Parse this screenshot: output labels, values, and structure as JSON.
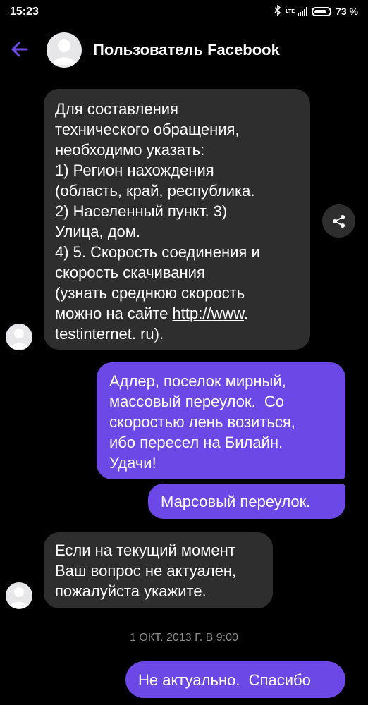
{
  "status_bar": {
    "time": "15:23",
    "network_label": "LTE",
    "battery_text": "73 %",
    "battery_level_percent": 73
  },
  "header": {
    "title": "Пользователь Facebook"
  },
  "messages": [
    {
      "direction": "incoming",
      "text_before_link": "Для составления\nтехнического обращения,\nнеобходимо указать:\n1) Регион нахождения\n(область, край, республика.\n2) Населенный пункт. 3)\nУлица, дом.\n4) 5. Скорость соединения и\nскорость скачивания\n(узнать среднюю скорость\nможно на сайте ",
      "link_text": "http://www",
      "text_after_link": ".\ntestinternet. ru)."
    },
    {
      "direction": "outgoing",
      "text": "Адлер, поселок мирный,\nмассовый переулок.  Со\nскоростью лень возиться,\nибо пересел на Билайн.\nУдачи!"
    },
    {
      "direction": "outgoing",
      "text": "Марсовый переулок."
    },
    {
      "direction": "incoming",
      "text": "Если на текущий момент\nВаш вопрос не актуален,\nпожалуйста укажите."
    },
    {
      "direction": "outgoing",
      "text": "Не актуально.  Спасибо"
    }
  ],
  "timestamp": "1 ОКТ. 2013 Г. В 9:00",
  "colors": {
    "background": "#000000",
    "incoming_bubble": "#2e2e2e",
    "outgoing_bubble": "#6c48e6",
    "accent": "#6c48e6",
    "timestamp_text": "#8a8a8a"
  },
  "icons": {
    "back": "arrow-left-icon",
    "share": "share-icon",
    "avatar": "default-user-avatar"
  }
}
